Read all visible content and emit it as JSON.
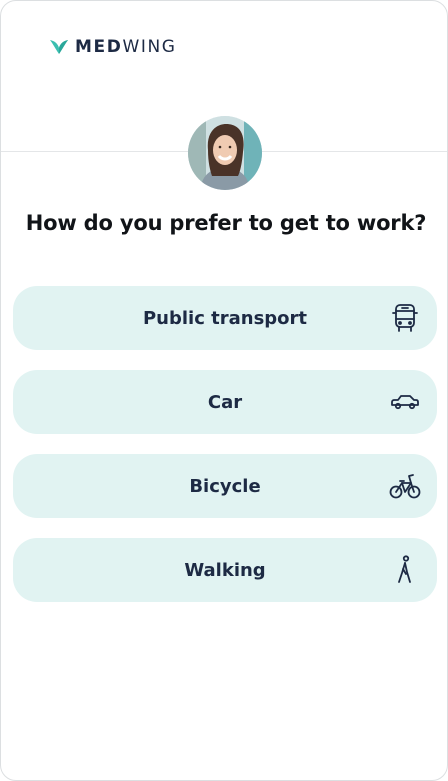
{
  "brand": {
    "name_bold": "MED",
    "name_rest": "WING",
    "accent": "#3bbfb0"
  },
  "question": "How do you prefer to get to work?",
  "options": [
    {
      "label": "Public transport",
      "icon": "bus-icon"
    },
    {
      "label": "Car",
      "icon": "car-icon"
    },
    {
      "label": "Bicycle",
      "icon": "bicycle-icon"
    },
    {
      "label": "Walking",
      "icon": "walking-icon"
    }
  ],
  "colors": {
    "option_bg": "#e1f3f2",
    "text": "#1d2a44"
  }
}
